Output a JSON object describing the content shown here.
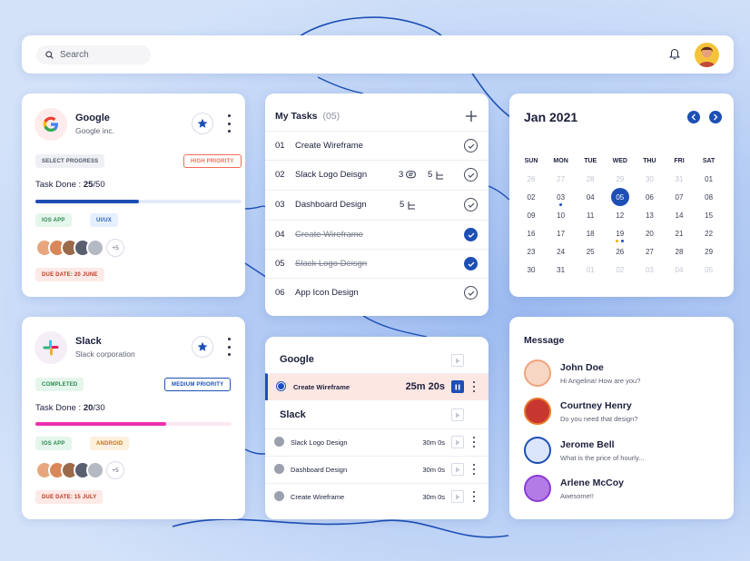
{
  "topbar": {
    "search_placeholder": "Search"
  },
  "projects": [
    {
      "name": "Google",
      "company": "Google inc.",
      "progress_label": "SELECT PROGRESS",
      "priority": "HIGH PRIORITY",
      "task_label": "Task Done :",
      "done": "25",
      "total": "/50",
      "progress": 0.5,
      "tags": [
        "IOS APP",
        "UI/UX"
      ],
      "extra_members": "+5",
      "due": "DUE DATE: 20 JUNE",
      "colors": {
        "bar": "#1d4fb5",
        "track": "#e3ebfa"
      }
    },
    {
      "name": "Slack",
      "company": "Slack corporation",
      "progress_label": "COMPLETED",
      "priority": "MEDIUM PRIORITY",
      "task_label": "Task Done :",
      "done": "20",
      "total": "/30",
      "progress": 0.667,
      "tags": [
        "IOS APP",
        "ANDROID"
      ],
      "extra_members": "+5",
      "due": "DUE DATE: 15 JULY",
      "colors": {
        "bar": "#ec2fb0",
        "track": "#fbe7f2"
      }
    }
  ],
  "tasks": {
    "title": "My Tasks",
    "count": "(05)",
    "items": [
      {
        "num": "01",
        "label": "Create Wireframe",
        "done": false
      },
      {
        "num": "02",
        "label": "Slack Logo Deisgn",
        "comments": "3",
        "subtasks": "5",
        "done": false
      },
      {
        "num": "03",
        "label": "Dashboard Design",
        "subtasks": "5",
        "done": false
      },
      {
        "num": "04",
        "label": "Create Wireframe",
        "done": true
      },
      {
        "num": "05",
        "label": "Slack Logo Deisgn",
        "done": true
      },
      {
        "num": "06",
        "label": "App Icon Design",
        "done": false
      }
    ]
  },
  "calendar": {
    "title": "Jan 2021",
    "days": [
      "SUN",
      "MON",
      "TUE",
      "WED",
      "THU",
      "FRI",
      "SAT"
    ],
    "weeks": [
      [
        "26",
        "27",
        "28",
        "29",
        "30",
        "31",
        "01"
      ],
      [
        "02",
        "03",
        "04",
        "05",
        "06",
        "07",
        "08"
      ],
      [
        "09",
        "10",
        "11",
        "12",
        "13",
        "14",
        "15"
      ],
      [
        "16",
        "17",
        "18",
        "19",
        "20",
        "21",
        "22"
      ],
      [
        "23",
        "24",
        "25",
        "26",
        "27",
        "28",
        "29"
      ],
      [
        "30",
        "31",
        "01",
        "02",
        "03",
        "04",
        "05"
      ]
    ],
    "selected": "05"
  },
  "timers": {
    "groups": [
      {
        "name": "Google",
        "items": [
          {
            "label": "Create Wireframe",
            "time": "25m 20s",
            "active": true
          }
        ]
      },
      {
        "name": "Slack",
        "items": [
          {
            "label": "Slack Logo Design",
            "time": "30m 0s"
          },
          {
            "label": "Dashboard Design",
            "time": "30m 0s"
          },
          {
            "label": "Create Wireframe",
            "time": "30m 0s"
          }
        ]
      }
    ]
  },
  "messages": {
    "title": "Message",
    "items": [
      {
        "name": "John Doe",
        "text": "Hi Angelina! How are you?",
        "ring": "#f2a37c"
      },
      {
        "name": "Courtney Henry",
        "text": "Do you need that design?",
        "ring": "#e8762b"
      },
      {
        "name": "Jerome Bell",
        "text": "What is the price of hourly...",
        "ring": "#1d4fb5"
      },
      {
        "name": "Arlene McCoy",
        "text": "Awesome!!",
        "ring": "#8a3cd6"
      }
    ]
  }
}
